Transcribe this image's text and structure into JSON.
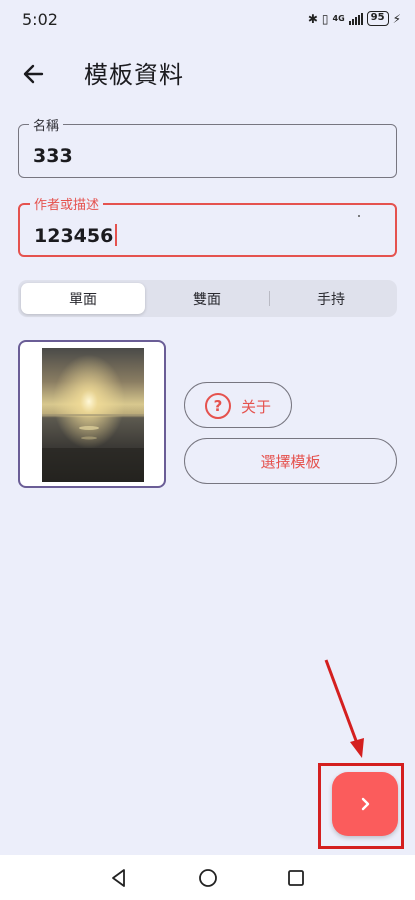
{
  "status_bar": {
    "time": "5:02",
    "network": "4G",
    "battery": "95"
  },
  "header": {
    "title": "模板資料"
  },
  "fields": {
    "name": {
      "label": "名稱",
      "value": "333"
    },
    "description": {
      "label": "作者或描述",
      "value": "123456"
    }
  },
  "segmented": {
    "items": [
      "單面",
      "雙面",
      "手持"
    ],
    "selected_index": 0
  },
  "actions": {
    "about_label": "关于",
    "about_icon_glyph": "?",
    "choose_template_label": "選擇模板"
  },
  "colors": {
    "accent": "#e5524e",
    "fab": "#fb5c5c",
    "background": "#eceefa",
    "preview_border": "#6a5d96",
    "annotation": "#d41f1f"
  },
  "icons": {
    "back": "arrow-left-icon",
    "fab": "chevron-right-icon",
    "about": "question-circle-icon"
  }
}
